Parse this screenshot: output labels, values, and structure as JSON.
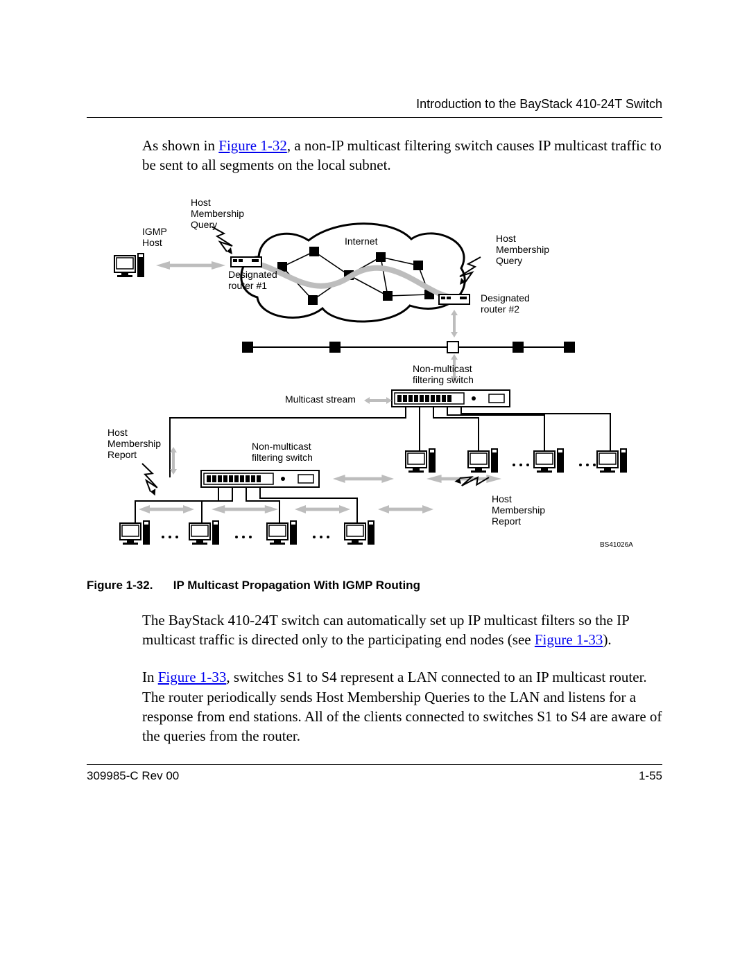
{
  "header": {
    "running_head": "Introduction to the BayStack 410-24T Switch"
  },
  "paragraphs": {
    "p1_a": "As shown in ",
    "p1_link": "Figure 1-32",
    "p1_b": ", a non-IP multicast filtering switch causes IP multicast traffic to be sent to all segments on the local subnet.",
    "p2_a": "The BayStack 410-24T switch can automatically set up IP multicast filters so the IP multicast traffic is directed only to the participating end nodes (see ",
    "p2_link": "Figure 1-33",
    "p2_b": ").",
    "p3_a": "In ",
    "p3_link": "Figure 1-33",
    "p3_b": ", switches S1 to S4 represent a LAN connected to an IP multicast router. The router periodically sends Host Membership Queries to the LAN and listens for a response from end stations. All of the clients connected to switches S1 to S4 are aware of the queries from the router."
  },
  "figure": {
    "caption_num": "Figure 1-32.",
    "caption_title": "IP Multicast Propagation With IGMP Routing",
    "labels": {
      "igmp_host": "IGMP\nHost",
      "hmq1": "Host\nMembership\nQuery",
      "hmq2": "Host\nMembership\nQuery",
      "dr1": "Designated\nrouter #1",
      "dr2": "Designated\nrouter #2",
      "internet": "Internet",
      "nmfs": "Non-multicast\nfiltering switch",
      "nmfs2": "Non-multicast\nfiltering switch",
      "mcast": "Multicast stream",
      "hmr1": "Host\nMembership\nReport",
      "hmr2": "Host\nMembership\nReport",
      "code": "BS41026A"
    }
  },
  "footer": {
    "doc_id": "309985-C Rev 00",
    "page_num": "1-55"
  }
}
